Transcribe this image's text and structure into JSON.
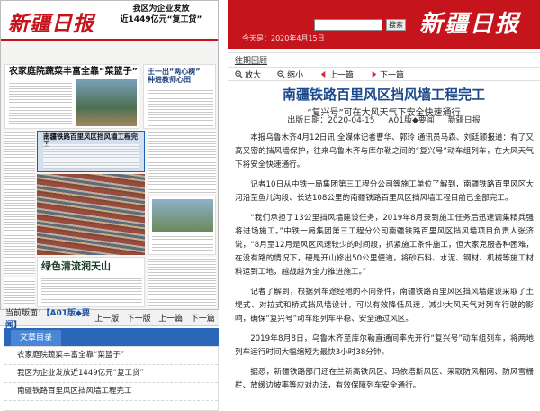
{
  "paper": {
    "logo": "新疆日报",
    "banner": "我区为企业发放\n近1449亿元“复工贷”",
    "headline_left": "农家庭院蔬菜丰富全靠“菜篮子”",
    "headline_right": "王一出“两心树”\n种进教师心田",
    "story_title": "南疆铁路百里风区挡风墙工程完工",
    "lower_title": "绿色清流润天山"
  },
  "left_toolbar": {
    "current_label": "当前版面：",
    "current_value": "【A01版◆要闻】",
    "buttons": [
      "上一版",
      "下一版",
      "上一篇",
      "下一篇"
    ]
  },
  "section": {
    "tab_label": "文章目录"
  },
  "toc": [
    "农家庭院蔬菜丰富全靠“菜篮子”",
    "我区为企业发放近1449亿元“复工贷”",
    "南疆铁路百里风区挡风墙工程完工"
  ],
  "right": {
    "logo": "新疆日报",
    "date_label": "今天是：2020年4月15日",
    "search_placeholder": "",
    "search_button": "搜索",
    "prev_page_link": "往期回顾",
    "tools": [
      {
        "icon": "zoom-in-icon",
        "label": "放大"
      },
      {
        "icon": "zoom-out-icon",
        "label": "缩小"
      },
      {
        "icon": "prev-icon",
        "label": "上一篇"
      },
      {
        "icon": "next-icon",
        "label": "下一篇"
      }
    ]
  },
  "article": {
    "title": "南疆铁路百里风区挡风墙工程完工",
    "subtitle": "“复兴号”可在大风天气下安全快速通行",
    "date": "出版日期：2020-04-15",
    "section": "A01版◆要闻",
    "source": "新疆日报",
    "paragraphs": [
      "本报乌鲁木齐4月12日讯 全媒体记者曹华、郭玲 通讯员马森、刘廷颖报道：有了又高又密的挡风墙保护，往来乌鲁木齐与库尔勒之间的“复兴号”动车组列车，在大风天气下将安全快速通行。",
      "记者10日从中铁一局集团第三工程分公司等施工单位了解到，南疆铁路百里风区大河沿至鱼儿沟段、长达108公里的南疆铁路百里风区挡风墙工程目前已全部完工。",
      "“我们承担了13公里挡风墙建设任务，2019年8月录到施工任务后迅速调集精兵强将进场施工。”中铁一局集团第三工程分公司南疆铁路百里风区挡风墙项目负责人张济说，“8月至12月是风区风速较少的时间段，抓紧施工条件施工，但大家克服各种困难，在没有路的情况下，硬是开山修出50公里便道，将砂石料、水泥、钢材、机械等施工材料运到工地，越战越为全力推进施工。”",
      "记者了解到，根据列车途经地的不同条件，南疆铁路百里风区挡风墙建设采取了土堤式、对拉式和桥式挡风墙设计，可以有效降低风速，减少大风天气对列车行驶的影响，确保“复兴号”动车组列车平稳、安全通过风区。",
      "2019年8月8日，乌鲁木齐至库尔勒直通间率先开行“复兴号”动车组列车，将两地列车运行时间大幅缩短为最快3小时38分钟。",
      "据悉，新疆铁路部门还在兰新高铁风区、玛依塔斯风区、采取防风棚网、防风雪栅栏、放缓边坡率等应对办法，有效保障列车安全通行。"
    ]
  },
  "colors": {
    "brand_red": "#c5141b",
    "title_blue": "#1b4a8a",
    "tab_blue": "#2b67b8"
  }
}
